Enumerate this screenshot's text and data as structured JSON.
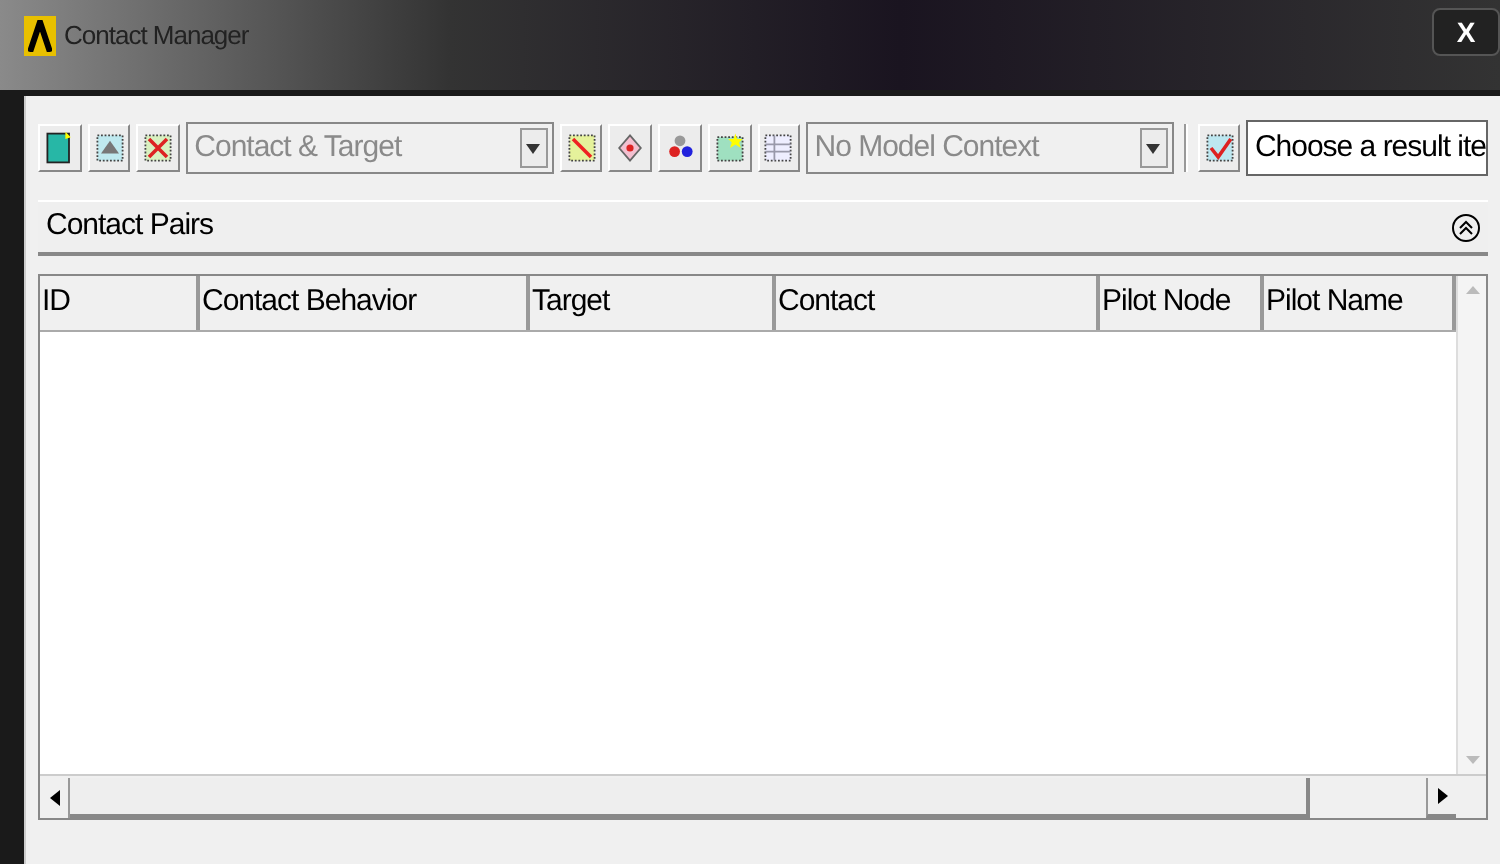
{
  "window": {
    "title": "Contact Manager",
    "close_label": "X"
  },
  "toolbar": [
    {
      "kind": "icon"
    },
    {
      "kind": "icon"
    },
    {
      "kind": "icon"
    },
    {
      "kind": "combo",
      "value": "Contact & Target",
      "disabled": true
    },
    {
      "kind": "icon"
    },
    {
      "kind": "icon"
    },
    {
      "kind": "icon"
    },
    {
      "kind": "icon"
    },
    {
      "kind": "icon"
    },
    {
      "kind": "combo",
      "value": "No Model Context",
      "disabled": true
    },
    {
      "kind": "separator"
    },
    {
      "kind": "icon"
    },
    {
      "kind": "field",
      "value": "Choose a result ite"
    }
  ],
  "panel": {
    "title": "Contact Pairs",
    "expanded": true
  },
  "table": {
    "columns": [
      "ID",
      "Contact Behavior",
      "Target",
      "Contact",
      "Pilot Node",
      "Pilot Name"
    ]
  }
}
